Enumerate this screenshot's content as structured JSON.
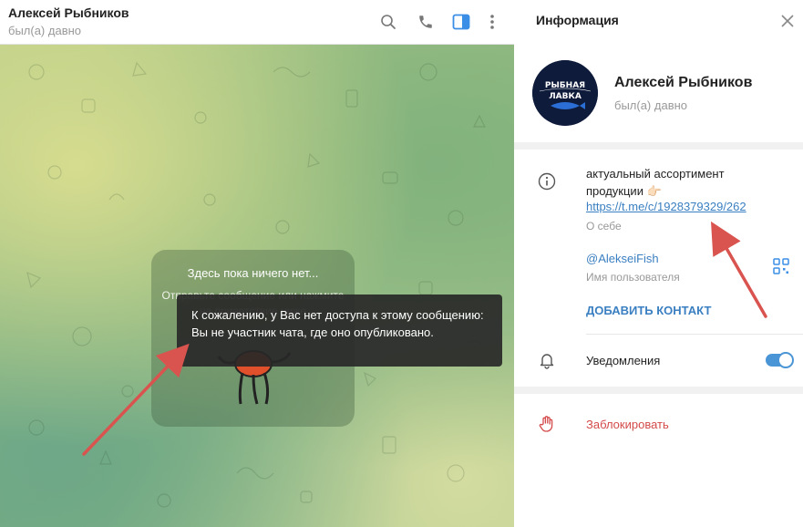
{
  "chat": {
    "title": "Алексей Рыбников",
    "status": "был(а) давно",
    "empty_title": "Здесь пока ничего нет...",
    "empty_subtitle": "Отправьте сообщение или нажмите на приветствие ниже",
    "tooltip": "К сожалению, у Вас нет доступа к этому сообщению: Вы не участник чата, где оно опубликовано."
  },
  "header_icons": [
    "search-icon",
    "phone-icon",
    "sidebar-toggle-icon",
    "more-vertical-icon"
  ],
  "info": {
    "title": "Информация",
    "name": "Алексей Рыбников",
    "status": "был(а) давно",
    "avatar_text": "РЫБНАЯ ЛАВКА",
    "about_text": "актуальный ассортимент продукции 👉🏻",
    "about_link": "https://t.me/c/1928379329/262",
    "about_label": "О себе",
    "username": "@AlekseiFish",
    "username_label": "Имя пользователя",
    "add_contact": "ДОБАВИТЬ КОНТАКТ",
    "notifications": "Уведомления",
    "notifications_on": true,
    "block": "Заблокировать"
  },
  "colors": {
    "accent": "#3a7fc1",
    "danger": "#d44a4a",
    "annotation_arrow": "#d9534f"
  }
}
